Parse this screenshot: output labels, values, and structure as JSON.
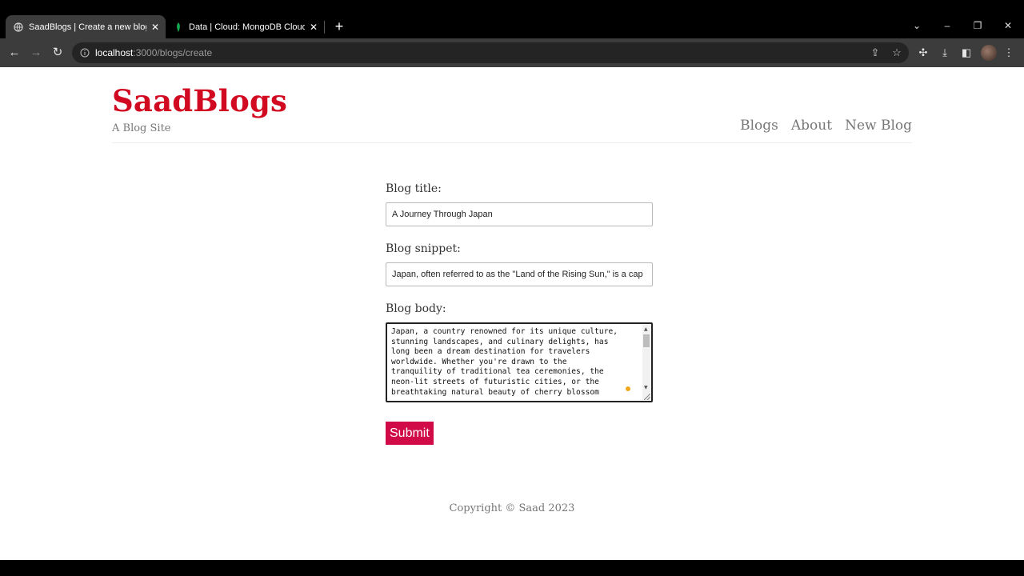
{
  "browser": {
    "tabs": [
      {
        "title": "SaadBlogs | Create a new blog",
        "active": true
      },
      {
        "title": "Data | Cloud: MongoDB Cloud",
        "active": false
      }
    ],
    "url": {
      "host": "localhost",
      "rest": ":3000/blogs/create"
    }
  },
  "site": {
    "brand": "SaadBlogs",
    "tagline": "A Blog Site",
    "nav": [
      "Blogs",
      "About",
      "New Blog"
    ],
    "brand_color": "#d10a22"
  },
  "form": {
    "title_label": "Blog title:",
    "title_value": "A Journey Through Japan",
    "snippet_label": "Blog snippet:",
    "snippet_value": "Japan, often referred to as the \"Land of the Rising Sun,\" is a cap",
    "body_label": "Blog body:",
    "body_value": "Japan, a country renowned for its unique culture,\nstunning landscapes, and culinary delights, has\nlong been a dream destination for travelers\nworldwide. Whether you're drawn to the\ntranquility of traditional tea ceremonies, the\nneon-lit streets of futuristic cities, or the\nbreathtaking natural beauty of cherry blossom",
    "submit_label": "Submit",
    "submit_color": "#d10a48"
  },
  "footer": {
    "copyright": "Copyright © Saad 2023"
  }
}
